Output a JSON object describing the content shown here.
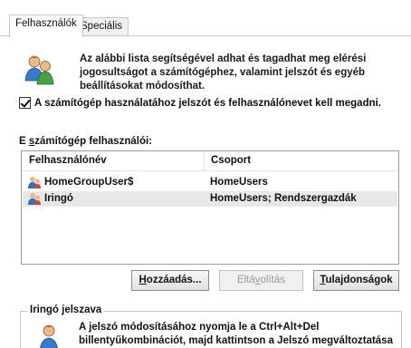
{
  "tabs": [
    {
      "label": "Felhasználók",
      "active": true
    },
    {
      "label": "Speciális",
      "active": false
    }
  ],
  "intro": {
    "line1": "Az alábbi lista segítségével adhat és tagadhat meg elérési",
    "line2": "jogosultságot a számítógéphez, valamint jelszót és egyéb",
    "line3": "beállításokat módosíthat."
  },
  "checkbox": {
    "label": "A számítógép használatához jelszót és felhasználónevet kell megadni.",
    "checked": true
  },
  "users_list": {
    "title_pre": "E ",
    "title_underlined": "s",
    "title_post": "zámítógép felhasználói:",
    "columns": [
      "Felhasználónév",
      "Csoport"
    ],
    "rows": [
      {
        "name": "HomeGroupUser$",
        "group": "HomeUsers",
        "selected": false
      },
      {
        "name": "Iringó",
        "group": "HomeUsers; Rendszergazdák",
        "selected": true
      }
    ]
  },
  "buttons": {
    "add": {
      "pre": "",
      "u": "H",
      "post": "ozzáadás..."
    },
    "remove": {
      "pre": "Eltá",
      "u": "v",
      "post": "olítás",
      "disabled": true
    },
    "properties": {
      "pre": "",
      "u": "T",
      "post": "ulajdonságok"
    }
  },
  "password_group": {
    "title": "Iringó jelszava",
    "line1": "A jelszó módosításához nyomja le a Ctrl+Alt+Del",
    "line2": "billentyűkombinációt, majd kattintson a Jelszó megváltoztatása"
  },
  "colors": {
    "selected_row": "#e8e8e8",
    "border": "#9a9a9a"
  }
}
